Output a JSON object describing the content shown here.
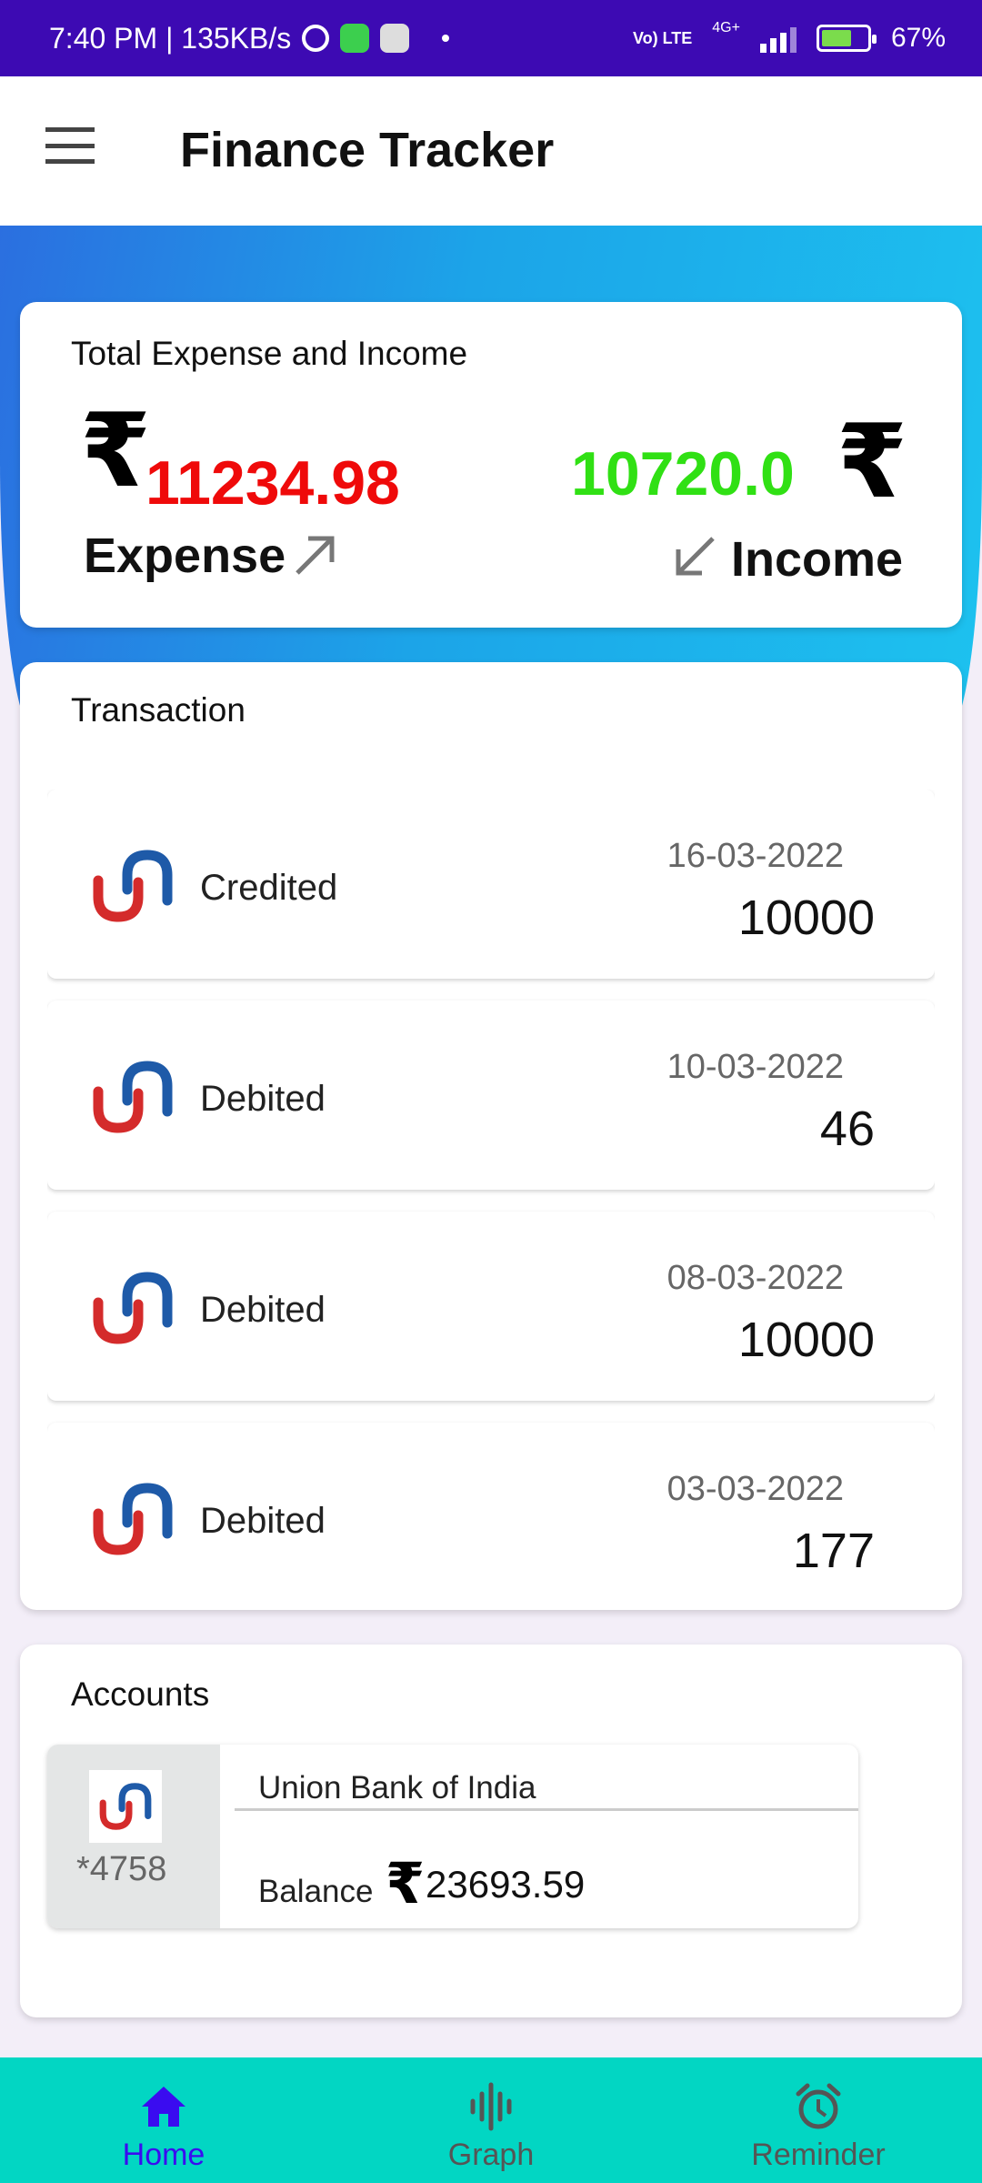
{
  "status_bar": {
    "left_text": "7:40 PM | 135KB/s",
    "volte": "Vo) LTE",
    "network": "4G+",
    "battery": "67%",
    "battery_level": 0.67
  },
  "app_bar": {
    "title": "Finance Tracker"
  },
  "summary": {
    "title": "Total Expense and Income",
    "currency_symbol": "₹",
    "expense_value": "11234.98",
    "expense_label": "Expense",
    "income_value": "10720.0",
    "income_label": "Income",
    "expense_color": "#ef0a0a",
    "income_color": "#30e014"
  },
  "transactions": {
    "title": "Transaction",
    "items": [
      {
        "type": "Credited",
        "date": "16-03-2022",
        "amount": "10000"
      },
      {
        "type": "Debited",
        "date": "10-03-2022",
        "amount": "46"
      },
      {
        "type": "Debited",
        "date": "08-03-2022",
        "amount": "10000"
      },
      {
        "type": "Debited",
        "date": "03-03-2022",
        "amount": "177"
      }
    ]
  },
  "accounts": {
    "title": "Accounts",
    "items": [
      {
        "account_number": "*4758",
        "bank_name": "Union Bank of India",
        "balance_label": "Balance",
        "balance": "23693.59"
      }
    ]
  },
  "bottom_nav": {
    "items": [
      {
        "label": "Home",
        "icon": "home-icon",
        "active": true
      },
      {
        "label": "Graph",
        "icon": "graph-icon",
        "active": false
      },
      {
        "label": "Reminder",
        "icon": "alarm-clock-icon",
        "active": false
      }
    ],
    "active_color": "#3a0cf0",
    "background": "#02d6c3"
  }
}
